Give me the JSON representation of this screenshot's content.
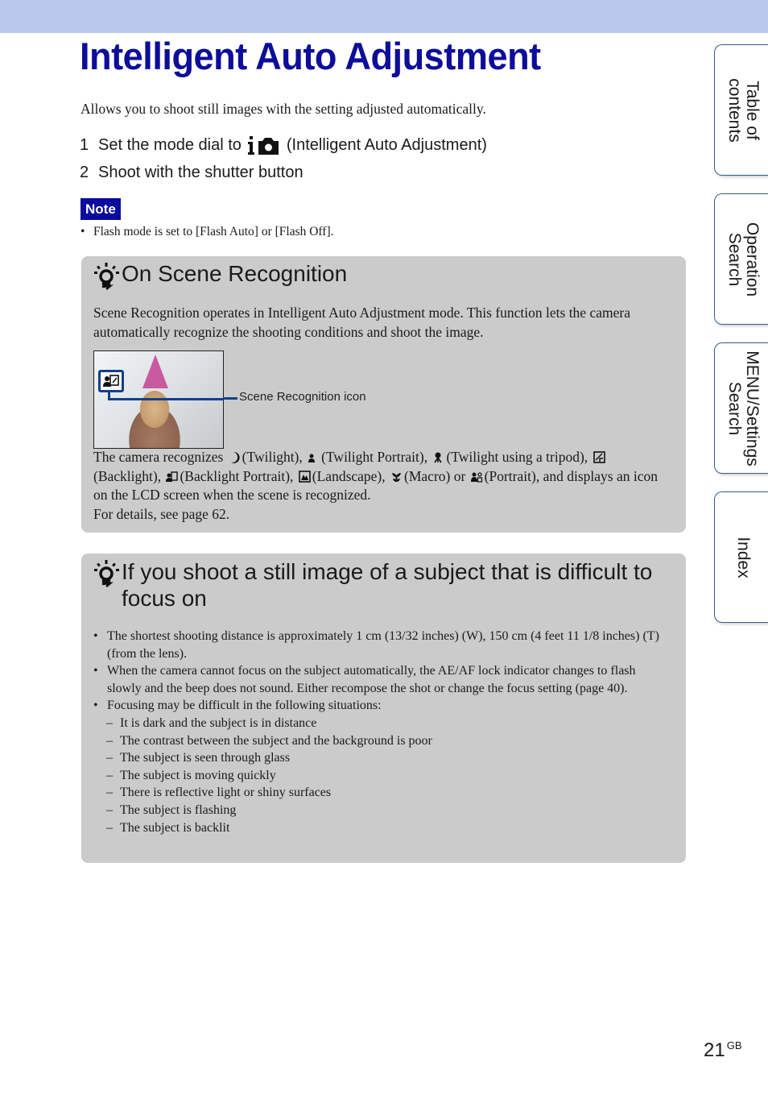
{
  "header": {
    "title": "Intelligent Auto Adjustment",
    "bar_color": "#b9c8ec",
    "title_color": "#0d0d9a"
  },
  "intro": "Allows you to shoot still images with the setting adjusted automatically.",
  "steps": [
    {
      "num": "1",
      "before": "Set the mode dial to",
      "icon": "intelligent-auto-camera-icon",
      "after": "(Intelligent Auto Adjustment)"
    },
    {
      "num": "2",
      "text": "Shoot with the shutter button"
    }
  ],
  "note": {
    "label": "Note",
    "bullet": "•",
    "items": [
      "Flash mode is set to [Flash Auto] or [Flash Off]."
    ]
  },
  "scene_recognition": {
    "heading": "On Scene Recognition",
    "heading_icon": "hint-lightbulb-icon",
    "para1": "Scene Recognition operates in Intelligent Auto Adjustment mode. This function lets the camera automatically recognize the shooting conditions and shoot the image.",
    "image_callout": "Scene Recognition icon",
    "recognizes_intro": "The camera recognizes",
    "scenes": [
      {
        "icon": "twilight-icon",
        "label": "(Twilight)"
      },
      {
        "icon": "twilight-portrait-icon",
        "label": "(Twilight Portrait)"
      },
      {
        "icon": "twilight-tripod-icon",
        "label": "(Twilight using a tripod)"
      },
      {
        "icon": "backlight-icon",
        "label": "(Backlight)"
      },
      {
        "icon": "backlight-portrait-icon",
        "label": "(Backlight Portrait)"
      },
      {
        "icon": "landscape-icon",
        "label": "(Landscape)"
      },
      {
        "icon": "macro-icon",
        "label": "(Macro)"
      },
      {
        "icon": "portrait-icon",
        "label": "(Portrait)"
      }
    ],
    "conj_or": "or",
    "conj_and": ", and",
    "tail": "displays an icon on the LCD screen when the scene is recognized.",
    "details": "For details, see page 62."
  },
  "focus_section": {
    "heading": "If you shoot a still image of a subject that is difficult to focus on",
    "heading_icon": "hint-lightbulb-icon",
    "bullets": [
      "The shortest shooting distance is approximately 1 cm (13/32 inches) (W), 150 cm (4 feet 11 1/8 inches) (T) (from the lens).",
      "When the camera cannot focus on the subject automatically, the AE/AF lock indicator changes to flash slowly and the beep does not sound. Either recompose the shot or change the focus setting (page 40).",
      "Focusing may be difficult in the following situations:"
    ],
    "sub_items": [
      "It is dark and the subject is in distance",
      "The contrast between the subject and the background is poor",
      "The subject is seen through glass",
      "The subject is moving quickly",
      "There is reflective light or shiny surfaces",
      "The subject is flashing",
      "The subject is backlit"
    ],
    "bullet": "•",
    "dash": "–"
  },
  "side_tabs": [
    {
      "label": "Table of\ncontents"
    },
    {
      "label": "Operation\nSearch"
    },
    {
      "label": "MENU/Settings\nSearch"
    },
    {
      "label": "Index"
    }
  ],
  "page": {
    "number": "21",
    "suffix": "GB"
  }
}
